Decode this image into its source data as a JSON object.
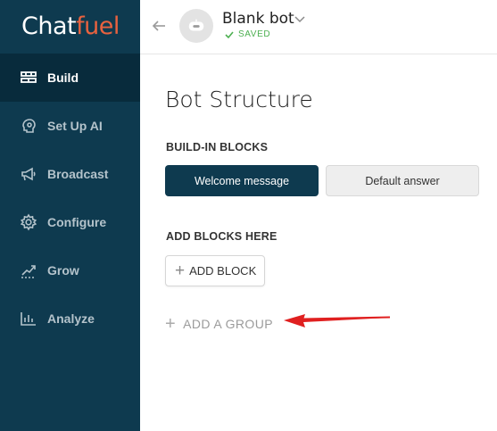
{
  "app": {
    "logo_part1": "Chat",
    "logo_part2": "fuel"
  },
  "sidebar": {
    "items": [
      {
        "label": "Build",
        "icon": "build-icon",
        "active": true
      },
      {
        "label": "Set Up AI",
        "icon": "ai-icon",
        "active": false
      },
      {
        "label": "Broadcast",
        "icon": "megaphone-icon",
        "active": false
      },
      {
        "label": "Configure",
        "icon": "gear-icon",
        "active": false
      },
      {
        "label": "Grow",
        "icon": "grow-icon",
        "active": false
      },
      {
        "label": "Analyze",
        "icon": "chart-icon",
        "active": false
      }
    ]
  },
  "header": {
    "bot_name": "Blank bot",
    "status": "SAVED"
  },
  "main": {
    "title": "Bot Structure",
    "builtin_label": "BUILD-IN BLOCKS",
    "builtin_blocks": [
      "Welcome message",
      "Default answer"
    ],
    "add_blocks_label": "ADD BLOCKS HERE",
    "add_block_button": "ADD BLOCK",
    "add_group_button": "ADD A GROUP"
  },
  "colors": {
    "sidebar_bg": "#0e3a4f",
    "active_bg": "#082b3c",
    "accent": "#e8623f",
    "saved": "#4caf50",
    "annotation": "#e02020"
  }
}
